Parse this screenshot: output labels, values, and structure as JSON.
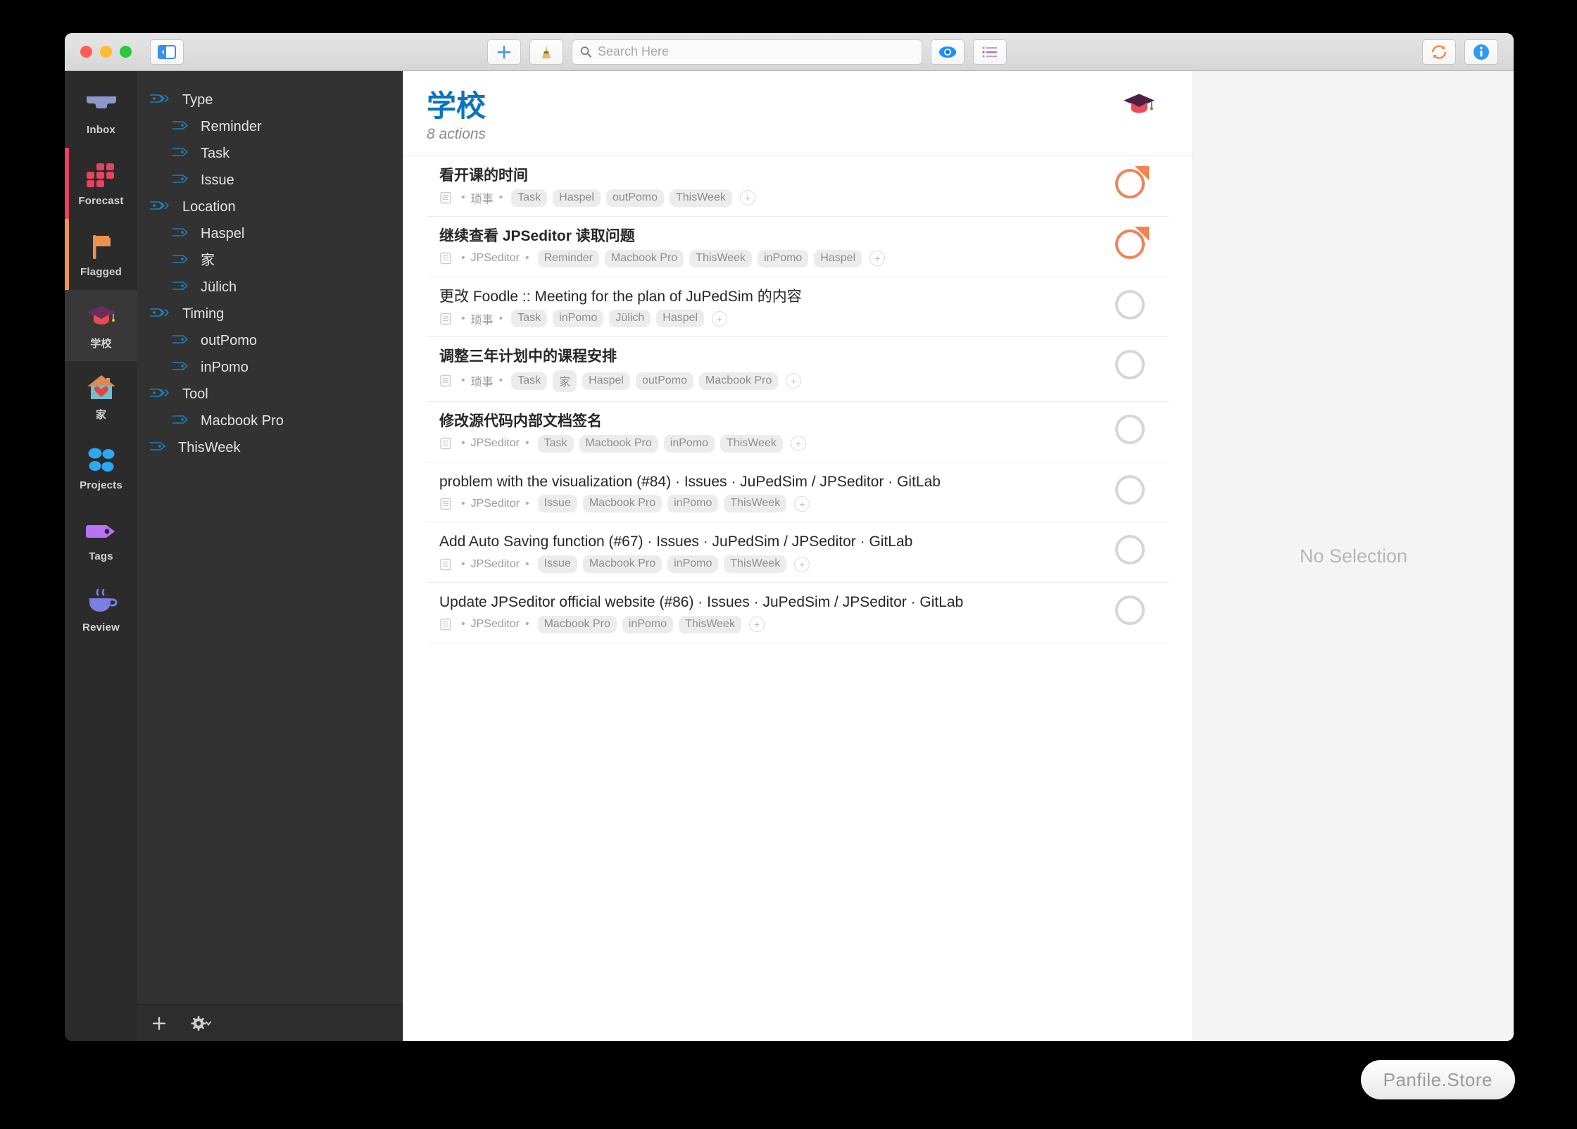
{
  "window": {
    "traffic_lights": [
      "close",
      "minimize",
      "zoom"
    ],
    "colors": {
      "accent_blue": "#0b74bc",
      "flag_orange": "#f4834f",
      "forecast_pink": "#e8435f",
      "tag_blue": "#1f7fb5"
    }
  },
  "toolbar": {
    "sidebar_toggle": "sidebar-toggle",
    "add_label": "+",
    "cleanup_label": "cleanup",
    "search": {
      "placeholder": "Search Here",
      "value": ""
    },
    "view_label": "view-options",
    "inspector_list_label": "list-layout",
    "sync_label": "sync",
    "info_label": "info"
  },
  "rail": {
    "items": [
      {
        "label": "Inbox",
        "icon": "inbox-icon",
        "selected": false,
        "bar": ""
      },
      {
        "label": "Forecast",
        "icon": "forecast-icon",
        "selected": false,
        "bar": "#e8435f"
      },
      {
        "label": "Flagged",
        "icon": "flag-icon",
        "selected": false,
        "bar": "#ef9354"
      },
      {
        "label": "学校",
        "icon": "graduation-cap-icon",
        "selected": true,
        "bar": ""
      },
      {
        "label": "家",
        "icon": "house-heart-icon",
        "selected": false,
        "bar": ""
      },
      {
        "label": "Projects",
        "icon": "projects-icon",
        "selected": false,
        "bar": ""
      },
      {
        "label": "Tags",
        "icon": "tag-icon",
        "selected": false,
        "bar": ""
      },
      {
        "label": "Review",
        "icon": "coffee-cup-icon",
        "selected": false,
        "bar": ""
      }
    ]
  },
  "tagbar": {
    "items": [
      {
        "label": "Type",
        "child": false
      },
      {
        "label": "Reminder",
        "child": true
      },
      {
        "label": "Task",
        "child": true
      },
      {
        "label": "Issue",
        "child": true
      },
      {
        "label": "Location",
        "child": false
      },
      {
        "label": "Haspel",
        "child": true
      },
      {
        "label": "家",
        "child": true
      },
      {
        "label": "Jülich",
        "child": true
      },
      {
        "label": "Timing",
        "child": false
      },
      {
        "label": "outPomo",
        "child": true
      },
      {
        "label": "inPomo",
        "child": true
      },
      {
        "label": "Tool",
        "child": false
      },
      {
        "label": "Macbook Pro",
        "child": true
      },
      {
        "label": "ThisWeek",
        "child": false
      }
    ],
    "footer": {
      "add_label": "add-tag",
      "settings_label": "tag-settings"
    }
  },
  "content": {
    "title": "学校",
    "count": "8 actions",
    "emblem": "graduation-cap-icon",
    "tasks": [
      {
        "title": "看开课的时间",
        "bold": true,
        "project": "琐事",
        "tags": [
          "Task",
          "Haspel",
          "outPomo",
          "ThisWeek"
        ],
        "add_tag": "+",
        "flagged": true
      },
      {
        "title": "继续查看 JPSeditor 读取问题",
        "bold": true,
        "project": "JPSeditor",
        "tags": [
          "Reminder",
          "Macbook Pro",
          "ThisWeek",
          "inPomo",
          "Haspel"
        ],
        "add_tag": "+",
        "flagged": true
      },
      {
        "title": "更改 Foodle :: Meeting for the plan of JuPedSim 的内容",
        "bold": false,
        "project": "琐事",
        "tags": [
          "Task",
          "inPomo",
          "Jülich",
          "Haspel"
        ],
        "add_tag": "+",
        "flagged": false
      },
      {
        "title": "调整三年计划中的课程安排",
        "bold": true,
        "project": "琐事",
        "tags": [
          "Task",
          "家",
          "Haspel",
          "outPomo",
          "Macbook Pro"
        ],
        "add_tag": "+",
        "flagged": false
      },
      {
        "title": "修改源代码内部文档签名",
        "bold": true,
        "project": "JPSeditor",
        "tags": [
          "Task",
          "Macbook Pro",
          "inPomo",
          "ThisWeek"
        ],
        "add_tag": "+",
        "flagged": false
      },
      {
        "title": "problem with the visualization (#84) · Issues · JuPedSim / JPSeditor · GitLab",
        "bold": false,
        "project": "JPSeditor",
        "tags": [
          "Issue",
          "Macbook Pro",
          "inPomo",
          "ThisWeek"
        ],
        "add_tag": "+",
        "flagged": false
      },
      {
        "title": "Add Auto Saving function (#67) · Issues · JuPedSim / JPSeditor · GitLab",
        "bold": false,
        "project": "JPSeditor",
        "tags": [
          "Issue",
          "Macbook Pro",
          "inPomo",
          "ThisWeek"
        ],
        "add_tag": "+",
        "flagged": false
      },
      {
        "title": "Update JPSeditor official website (#86) · Issues · JuPedSim / JPSeditor · GitLab",
        "bold": false,
        "project": "JPSeditor",
        "tags": [
          "Macbook Pro",
          "inPomo",
          "ThisWeek"
        ],
        "add_tag": "+",
        "flagged": false
      }
    ]
  },
  "inspector": {
    "empty_label": "No Selection"
  },
  "watermark": {
    "label": "Panfile.Store"
  }
}
